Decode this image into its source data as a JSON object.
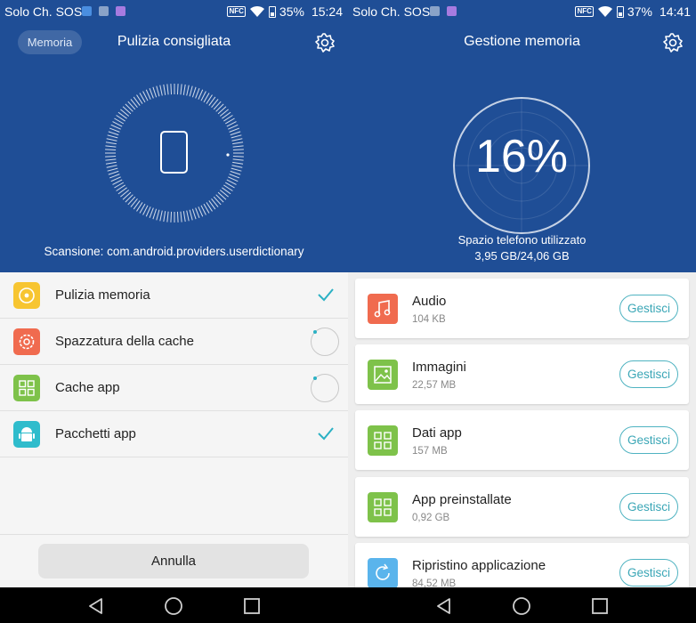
{
  "left": {
    "status": {
      "carrier": "Solo Ch. SOS",
      "nfc": "NFC",
      "battery": "35%",
      "time": "15:24"
    },
    "header": {
      "chip": "Memoria",
      "title": "Pulizia consigliata"
    },
    "scan_text": "Scansione: com.android.providers.userdictionary",
    "items": [
      {
        "label": "Pulizia memoria",
        "color": "#f7c531",
        "state": "done"
      },
      {
        "label": "Spazzatura della cache",
        "color": "#f06b4f",
        "state": "scanning"
      },
      {
        "label": "Cache app",
        "color": "#7ec24a",
        "state": "scanning"
      },
      {
        "label": "Pacchetti app",
        "color": "#2fbccc",
        "state": "done"
      }
    ],
    "cancel_label": "Annulla"
  },
  "right": {
    "status": {
      "carrier": "Solo Ch. SOS",
      "nfc": "NFC",
      "battery": "37%",
      "time": "14:41"
    },
    "header": {
      "title": "Gestione memoria"
    },
    "usage_percent": "16%",
    "usage_label": "Spazio telefono utilizzato",
    "usage_value": "3,95 GB/24,06 GB",
    "categories": [
      {
        "name": "Audio",
        "size": "104 KB",
        "button": "Gestisci",
        "color": "#f06b4f",
        "icon": "music-note-icon"
      },
      {
        "name": "Immagini",
        "size": "22,57 MB",
        "button": "Gestisci",
        "color": "#7ec24a",
        "icon": "image-icon"
      },
      {
        "name": "Dati app",
        "size": "157 MB",
        "button": "Gestisci",
        "color": "#7ec24a",
        "icon": "app-grid-icon"
      },
      {
        "name": "App preinstallate",
        "size": "0,92 GB",
        "button": "Gestisci",
        "color": "#7ec24a",
        "icon": "app-grid-icon"
      },
      {
        "name": "Ripristino applicazione",
        "size": "84,52 MB",
        "button": "Gestisci",
        "color": "#5ab4ec",
        "icon": "restore-icon"
      }
    ]
  },
  "colors": {
    "header_blue": "#1f4e96",
    "accent_teal": "#2bb1c4"
  }
}
